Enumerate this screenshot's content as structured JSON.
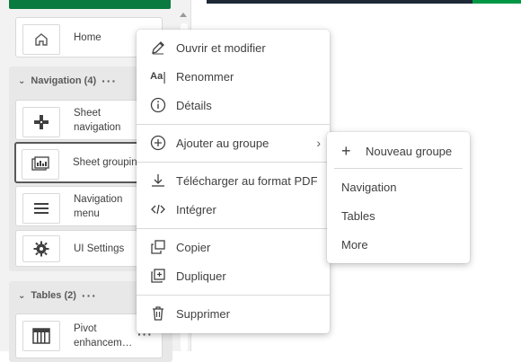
{
  "sidebar": {
    "home_label": "Home",
    "navigation_section": {
      "title": "Navigation (4)",
      "more": "···"
    },
    "navigation_items": [
      {
        "label": "Sheet navigation",
        "icon": "sheet-navigation-icon"
      },
      {
        "label": "Sheet grouping",
        "icon": "sheet-grouping-icon"
      },
      {
        "label": "Navigation menu",
        "icon": "navigation-menu-icon"
      },
      {
        "label": "UI Settings",
        "icon": "gear-icon"
      }
    ],
    "tables_section": {
      "title": "Tables (2)",
      "more": "···"
    },
    "tables_items": [
      {
        "label": "Pivot enhancem…",
        "icon": "pivot-table-icon",
        "more": "···"
      }
    ],
    "colors": {
      "panel": "#f2f2f2",
      "accent": "#009845",
      "topbar": "#1d2a36"
    }
  },
  "context_menu": {
    "items": [
      {
        "label": "Ouvrir et modifier",
        "icon": "pencil-icon"
      },
      {
        "label": "Renommer",
        "icon": "rename-icon"
      },
      {
        "label": "Détails",
        "icon": "info-icon"
      },
      {
        "label": "Ajouter au groupe",
        "icon": "add-circle-icon",
        "submenu_arrow": "›"
      },
      {
        "label": "Télécharger au format PDF",
        "icon": "download-icon"
      },
      {
        "label": "Intégrer",
        "icon": "embed-code-icon"
      },
      {
        "label": "Copier",
        "icon": "copy-icon"
      },
      {
        "label": "Dupliquer",
        "icon": "duplicate-icon"
      },
      {
        "label": "Supprimer",
        "icon": "trash-icon"
      }
    ],
    "rename_icon_text": "Aa"
  },
  "submenu": {
    "new_group_label": "Nouveau groupe",
    "new_group_icon_text": "+",
    "groups": [
      "Navigation",
      "Tables",
      "More"
    ]
  }
}
